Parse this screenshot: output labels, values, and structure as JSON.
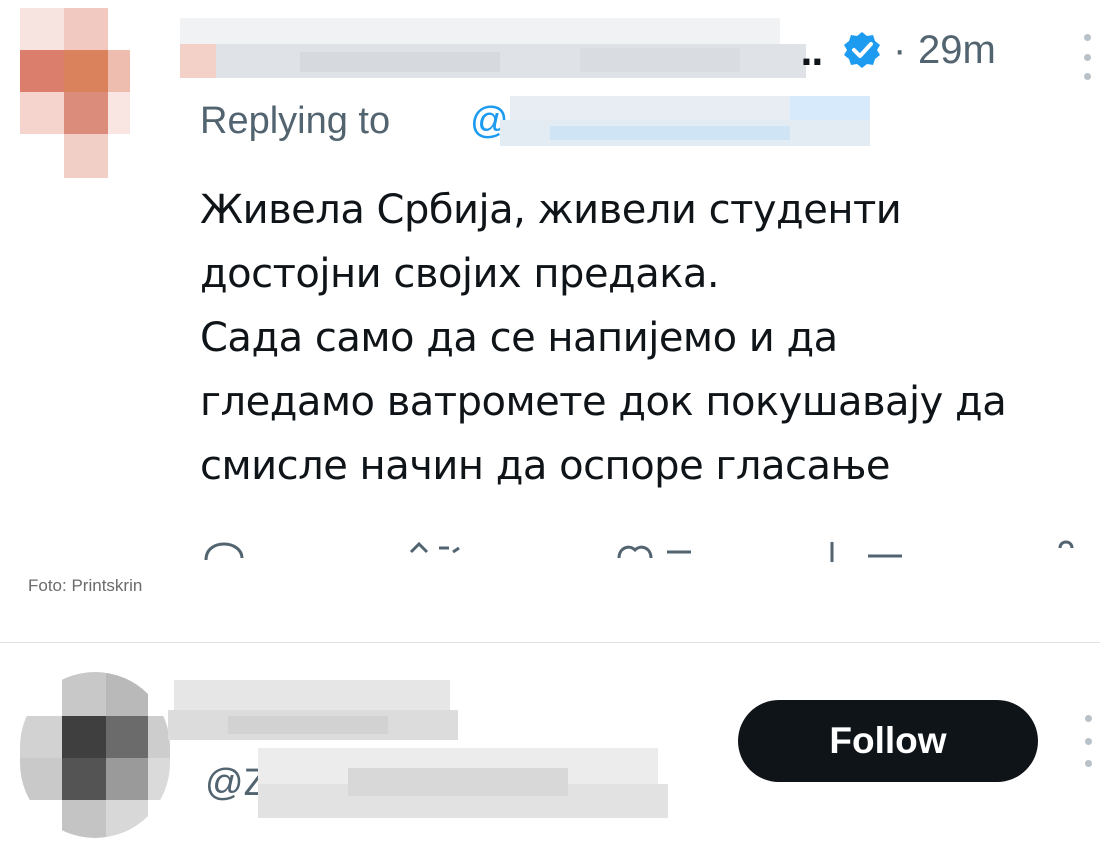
{
  "tweet": {
    "ellipsis": "..",
    "separator": "·",
    "time": "29m",
    "replying_prefix": "Replying to",
    "mention_prefix": "@",
    "text_lines": [
      "Живела Србија, живели студенти",
      "достојни својих предака.",
      "Сада само да се напијемо и да",
      "гледамо ватромете док покушавају да",
      "смисле начин да оспоре гласање"
    ],
    "icons": {
      "verified": "verified-badge-icon",
      "more": "more-options-icon",
      "reply": "reply-icon",
      "retweet": "retweet-icon",
      "like": "like-icon",
      "views": "views-icon",
      "bookmark": "bookmark-icon"
    },
    "colors": {
      "accent": "#1d9bf0",
      "muted": "#536471",
      "text": "#0f1419"
    }
  },
  "caption": "Foto: Printskrin",
  "suggestion": {
    "handle_prefix": "@",
    "handle_first_char": "Z",
    "follow_label": "Follow",
    "follow_bg": "#0f1419"
  }
}
